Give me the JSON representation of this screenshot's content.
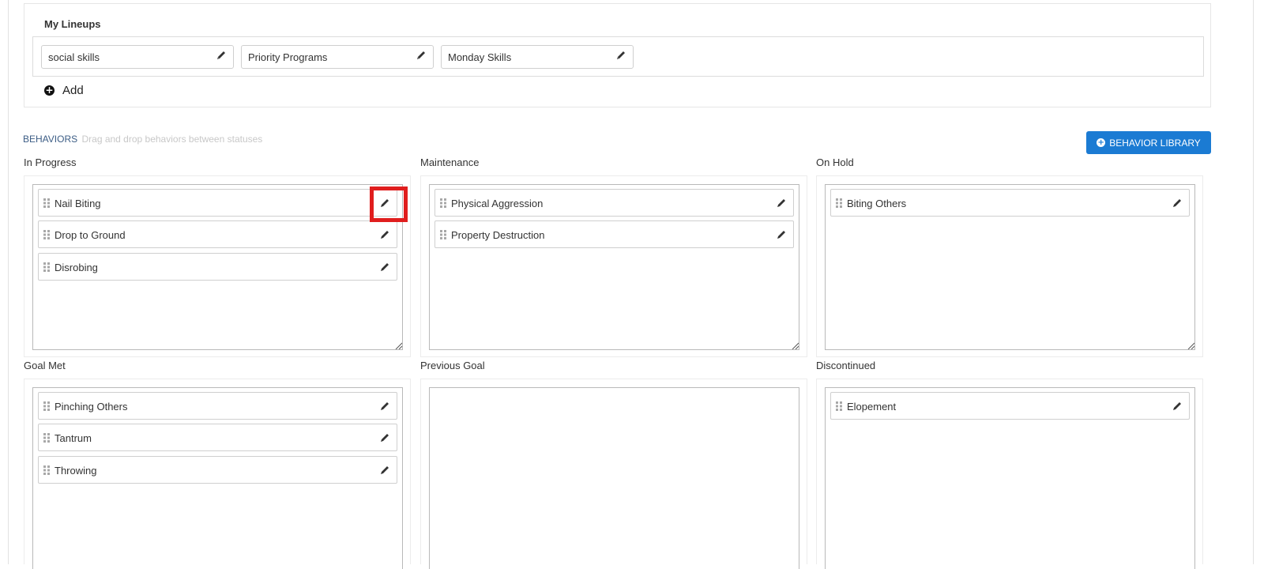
{
  "lineups": {
    "title": "My Lineups",
    "items": [
      {
        "label": "social skills"
      },
      {
        "label": "Priority Programs"
      },
      {
        "label": "Monday Skills"
      }
    ],
    "add_label": "Add"
  },
  "behaviors": {
    "title": "BEHAVIORS",
    "hint": "Drag and drop behaviors between statuses",
    "library_button": "BEHAVIOR LIBRARY",
    "statuses": [
      {
        "name": "In Progress",
        "items": [
          "Nail Biting",
          "Drop to Ground",
          "Disrobing"
        ]
      },
      {
        "name": "Maintenance",
        "items": [
          "Physical Aggression",
          "Property Destruction"
        ]
      },
      {
        "name": "On Hold",
        "items": [
          "Biting Others"
        ]
      },
      {
        "name": "Goal Met",
        "items": [
          "Pinching Others",
          "Tantrum",
          "Throwing"
        ]
      },
      {
        "name": "Previous Goal",
        "items": []
      },
      {
        "name": "Discontinued",
        "items": [
          "Elopement"
        ]
      }
    ]
  },
  "icons": {
    "edit": "pencil-icon",
    "drag": "drag-handle-icon",
    "add": "plus-circle-icon",
    "resize": "resize-grip-icon"
  },
  "colors": {
    "accent": "#1b7bd3",
    "highlight": "#e01e1e",
    "section_title": "#3c5d85"
  }
}
